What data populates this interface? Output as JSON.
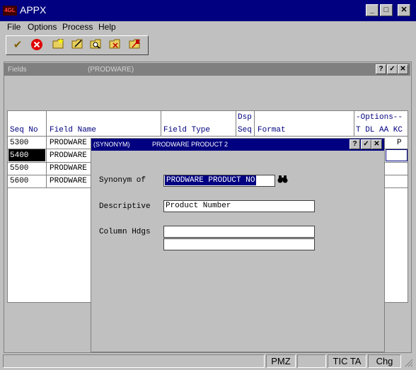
{
  "app": {
    "logo_text": "APPX",
    "title": "APPX"
  },
  "menu": [
    "File",
    "Options",
    "Process",
    "Help"
  ],
  "toolbar": {
    "icons": [
      "check-folder-icon",
      "stop-icon",
      "folder-new-icon",
      "folder-edit-icon",
      "folder-search-icon",
      "folder-delete-icon",
      "folder-flag-icon"
    ]
  },
  "fields_window": {
    "title": "Fields",
    "subtitle": "(PRODWARE)",
    "columns": {
      "seq_no": "Seq No",
      "field_name": "Field Name",
      "field_type": "Field Type",
      "dsp": "Dsp",
      "seq": "Seq",
      "format": "Format",
      "options": "-Options--",
      "options_sub": "T DL AA KC"
    },
    "rows": [
      {
        "seq": "5300",
        "name": "PRODWARE",
        "kc": "P"
      },
      {
        "seq": "5400",
        "name": "PRODWARE",
        "kc": ""
      },
      {
        "seq": "5500",
        "name": "PRODWARE",
        "kc": ""
      },
      {
        "seq": "5600",
        "name": "PRODWARE",
        "kc": ""
      }
    ]
  },
  "synonym_dialog": {
    "title": "(SYNONYM)",
    "subtitle": "PRODWARE PRODUCT 2",
    "synonym_of_label": "Synonym of",
    "synonym_of_value": "PRODWARE PRODUCT NO",
    "descriptive_label": "Descriptive",
    "descriptive_value": "Product Number",
    "column_hdgs_label": "Column Hdgs",
    "column_hdg_1": "",
    "column_hdg_2": ""
  },
  "status_bar": [
    "",
    "PMZ",
    "",
    "TIC TA",
    "Chg"
  ]
}
